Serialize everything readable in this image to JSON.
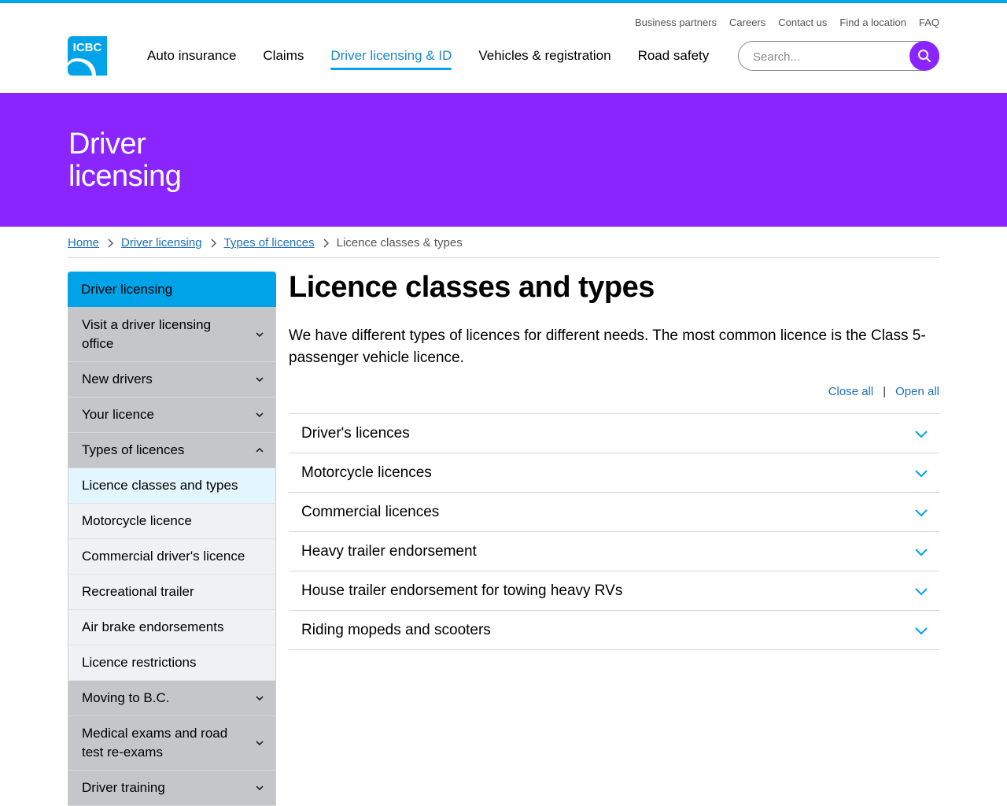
{
  "utility_nav": [
    "Business partners",
    "Careers",
    "Contact us",
    "Find a location",
    "FAQ"
  ],
  "logo": {
    "text": "ICBC",
    "color": "#00a3e8"
  },
  "main_nav": [
    {
      "label": "Auto insurance",
      "active": false
    },
    {
      "label": "Claims",
      "active": false
    },
    {
      "label": "Driver licensing & ID",
      "active": true
    },
    {
      "label": "Vehicles & registration",
      "active": false
    },
    {
      "label": "Road safety",
      "active": false
    }
  ],
  "search": {
    "placeholder": "Search...",
    "value": "",
    "icon": "search-icon"
  },
  "hero": {
    "title": "Driver licensing"
  },
  "breadcrumb": {
    "links": [
      "Home",
      "Driver licensing",
      "Types of licences"
    ],
    "current": "Licence classes & types"
  },
  "sidebar": {
    "header": "Driver licensing",
    "items": [
      {
        "label": "Visit a driver licensing office",
        "type": "group",
        "expanded": false
      },
      {
        "label": "New drivers",
        "type": "group",
        "expanded": false
      },
      {
        "label": "Your licence",
        "type": "group",
        "expanded": false
      },
      {
        "label": "Types of licences",
        "type": "group",
        "expanded": true
      },
      {
        "label": "Licence classes and types",
        "type": "sub",
        "current": true
      },
      {
        "label": "Motorcycle licence",
        "type": "sub"
      },
      {
        "label": "Commercial driver's licence",
        "type": "sub"
      },
      {
        "label": "Recreational trailer",
        "type": "sub"
      },
      {
        "label": "Air brake endorsements",
        "type": "sub"
      },
      {
        "label": "Licence restrictions",
        "type": "sub"
      },
      {
        "label": "Moving to B.C.",
        "type": "group",
        "expanded": false
      },
      {
        "label": "Medical exams and road test re-exams",
        "type": "group",
        "expanded": false
      },
      {
        "label": "Driver training",
        "type": "group",
        "expanded": false
      }
    ]
  },
  "main": {
    "title": "Licence classes and types",
    "intro": "We have different types of licences for different needs. The most common licence is the Class 5-passenger vehicle licence.",
    "close_all": "Close all",
    "divider": "|",
    "open_all": "Open all",
    "accordion": [
      "Driver's licences",
      "Motorcycle licences",
      "Commercial licences",
      "Heavy trailer endorsement",
      "House trailer endorsement for towing heavy RVs",
      "Riding mopeds and scooters"
    ]
  },
  "colors": {
    "accent_blue": "#00a3e8",
    "link_blue": "#1e70b8",
    "brand_purple": "#8a25ff"
  }
}
